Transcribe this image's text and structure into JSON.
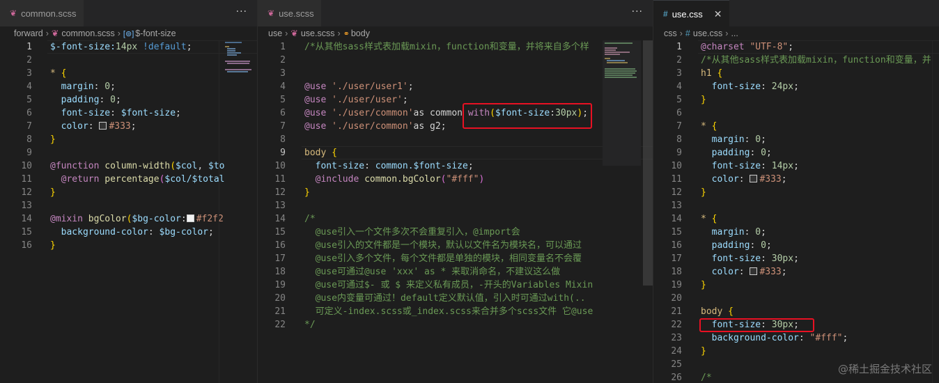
{
  "panes": [
    {
      "tab": {
        "label": "common.scss",
        "icon": "sass-icon"
      },
      "breadcrumb": [
        "forward",
        "common.scss",
        "$-font-size"
      ],
      "current_line": 1,
      "lines": [
        [
          [
            "$-font-size:",
            "var"
          ],
          [
            "14px",
            "num"
          ],
          [
            " !default",
            "kw"
          ],
          [
            ";",
            "p"
          ]
        ],
        [],
        [
          [
            "* ",
            "sel"
          ],
          [
            "{",
            "br1"
          ]
        ],
        [
          [
            "  margin",
            "prop"
          ],
          [
            ": ",
            "p"
          ],
          [
            "0",
            "num"
          ],
          [
            ";",
            "p"
          ]
        ],
        [
          [
            "  padding",
            "prop"
          ],
          [
            ": ",
            "p"
          ],
          [
            "0",
            "num"
          ],
          [
            ";",
            "p"
          ]
        ],
        [
          [
            "  font-size",
            "prop"
          ],
          [
            ": ",
            "p"
          ],
          [
            "$font-size",
            "var"
          ],
          [
            ";",
            "p"
          ]
        ],
        [
          [
            "  color",
            "prop"
          ],
          [
            ": ",
            "p"
          ],
          [
            "#333",
            "str",
            "#333333"
          ],
          [
            ";",
            "p"
          ]
        ],
        [
          [
            "}",
            "br1"
          ]
        ],
        [],
        [
          [
            "@function ",
            "at"
          ],
          [
            "column-width",
            "fn"
          ],
          [
            "(",
            "br1"
          ],
          [
            "$col",
            "var"
          ],
          [
            ", ",
            "p"
          ],
          [
            "$to",
            "var"
          ]
        ],
        [
          [
            "  @return ",
            "at"
          ],
          [
            "percentage",
            "fn"
          ],
          [
            "(",
            "br2"
          ],
          [
            "$col/$total",
            "var"
          ]
        ],
        [
          [
            "}",
            "br1"
          ]
        ],
        [],
        [
          [
            "@mixin ",
            "at"
          ],
          [
            "bgColor",
            "fn"
          ],
          [
            "(",
            "br1"
          ],
          [
            "$bg-color",
            "var"
          ],
          [
            ":",
            "p"
          ],
          [
            "#f2f2",
            "str",
            "#f2f2f2"
          ]
        ],
        [
          [
            "  background-color",
            "prop"
          ],
          [
            ": ",
            "p"
          ],
          [
            "$bg-color",
            "var"
          ],
          [
            ";",
            "p"
          ]
        ],
        [
          [
            "}",
            "br1"
          ]
        ]
      ]
    },
    {
      "tab": {
        "label": "use.scss",
        "icon": "sass-icon"
      },
      "breadcrumb": [
        "use",
        "use.scss",
        "body"
      ],
      "current_line": 9,
      "lines": [
        [
          [
            "/*从其他sass样式表加载mixin，function和变量，并将来自多个样",
            "com"
          ]
        ],
        [],
        [],
        [
          [
            "@use ",
            "at"
          ],
          [
            "'./user/user1'",
            "str"
          ],
          [
            ";",
            "p"
          ]
        ],
        [
          [
            "@use ",
            "at"
          ],
          [
            "'./user/user'",
            "str"
          ],
          [
            ";",
            "p"
          ]
        ],
        [
          [
            "@use ",
            "at"
          ],
          [
            "'./user/common'",
            "str"
          ],
          [
            "as common ",
            "p"
          ],
          [
            "with",
            "at"
          ],
          [
            "(",
            "br1"
          ],
          [
            "$font-size",
            "var"
          ],
          [
            ":",
            "p"
          ],
          [
            "30px",
            "num"
          ],
          [
            ")",
            "br1"
          ],
          [
            ";",
            "p"
          ]
        ],
        [
          [
            "@use ",
            "at"
          ],
          [
            "'./user/common'",
            "str"
          ],
          [
            "as g2",
            "p"
          ],
          [
            ";",
            "p"
          ]
        ],
        [],
        [
          [
            "body ",
            "tag"
          ],
          [
            "{",
            "br1"
          ]
        ],
        [
          [
            "  font-size",
            "prop"
          ],
          [
            ": ",
            "p"
          ],
          [
            "common.$font-size",
            "var"
          ],
          [
            ";",
            "p"
          ]
        ],
        [
          [
            "  @include ",
            "at"
          ],
          [
            "common.bgColor",
            "fn"
          ],
          [
            "(",
            "br2"
          ],
          [
            "\"#fff\"",
            "str"
          ],
          [
            ")",
            "br2"
          ]
        ],
        [
          [
            "}",
            "br1"
          ]
        ],
        [],
        [
          [
            "/*",
            "com"
          ]
        ],
        [
          [
            "  @use引入一个文件多次不会重复引入，@import会",
            "com"
          ]
        ],
        [
          [
            "  @use引入的文件都是一个模块，默认以文件名为模块名，可以通过",
            "com"
          ]
        ],
        [
          [
            "  @use引入多个文件，每个文件都是单独的模块，相同变量名不会覆",
            "com"
          ]
        ],
        [
          [
            "  @use可通过@use 'xxx' as * 来取消命名，不建议这么做",
            "com"
          ]
        ],
        [
          [
            "  @use可通过$- 或 $ 来定义私有成员，-开头的Variables Mixin",
            "com"
          ]
        ],
        [
          [
            "  @use内变量可通过！default定义默认值，引入时可通过with(..",
            "com"
          ]
        ],
        [
          [
            "  可定义-index.scss或_index.scss来合并多个scss文件 它@use",
            "com"
          ]
        ],
        [
          [
            "*/",
            "com"
          ]
        ]
      ]
    },
    {
      "tab": {
        "label": "use.css",
        "icon": "css-hash-icon"
      },
      "breadcrumb": [
        "css",
        "use.css",
        "..."
      ],
      "current_line": 1,
      "lines": [
        [
          [
            "@charset ",
            "at"
          ],
          [
            "\"UTF-8\"",
            "str"
          ],
          [
            ";",
            "p"
          ]
        ],
        [
          [
            "/*从其他sass样式表加载mixin，function和变量，并",
            "com"
          ]
        ],
        [
          [
            "h1 ",
            "tag"
          ],
          [
            "{",
            "br1"
          ]
        ],
        [
          [
            "  font-size",
            "prop"
          ],
          [
            ": ",
            "p"
          ],
          [
            "24px",
            "num"
          ],
          [
            ";",
            "p"
          ]
        ],
        [
          [
            "}",
            "br1"
          ]
        ],
        [],
        [
          [
            "* ",
            "sel"
          ],
          [
            "{",
            "br1"
          ]
        ],
        [
          [
            "  margin",
            "prop"
          ],
          [
            ": ",
            "p"
          ],
          [
            "0",
            "num"
          ],
          [
            ";",
            "p"
          ]
        ],
        [
          [
            "  padding",
            "prop"
          ],
          [
            ": ",
            "p"
          ],
          [
            "0",
            "num"
          ],
          [
            ";",
            "p"
          ]
        ],
        [
          [
            "  font-size",
            "prop"
          ],
          [
            ": ",
            "p"
          ],
          [
            "14px",
            "num"
          ],
          [
            ";",
            "p"
          ]
        ],
        [
          [
            "  color",
            "prop"
          ],
          [
            ": ",
            "p"
          ],
          [
            "#333",
            "str",
            "#333333"
          ],
          [
            ";",
            "p"
          ]
        ],
        [
          [
            "}",
            "br1"
          ]
        ],
        [],
        [
          [
            "* ",
            "sel"
          ],
          [
            "{",
            "br1"
          ]
        ],
        [
          [
            "  margin",
            "prop"
          ],
          [
            ": ",
            "p"
          ],
          [
            "0",
            "num"
          ],
          [
            ";",
            "p"
          ]
        ],
        [
          [
            "  padding",
            "prop"
          ],
          [
            ": ",
            "p"
          ],
          [
            "0",
            "num"
          ],
          [
            ";",
            "p"
          ]
        ],
        [
          [
            "  font-size",
            "prop"
          ],
          [
            ": ",
            "p"
          ],
          [
            "30px",
            "num"
          ],
          [
            ";",
            "p"
          ]
        ],
        [
          [
            "  color",
            "prop"
          ],
          [
            ": ",
            "p"
          ],
          [
            "#333",
            "str",
            "#333333"
          ],
          [
            ";",
            "p"
          ]
        ],
        [
          [
            "}",
            "br1"
          ]
        ],
        [],
        [
          [
            "body ",
            "tag"
          ],
          [
            "{",
            "br1"
          ]
        ],
        [
          [
            "  font-size",
            "prop"
          ],
          [
            ": ",
            "p"
          ],
          [
            "30px",
            "num"
          ],
          [
            ";",
            "p"
          ]
        ],
        [
          [
            "  background-color",
            "prop"
          ],
          [
            ": ",
            "p"
          ],
          [
            "\"#fff\"",
            "str"
          ],
          [
            ";",
            "p"
          ]
        ],
        [
          [
            "}",
            "br1"
          ]
        ],
        [],
        [
          [
            "/*",
            "com"
          ]
        ]
      ]
    }
  ],
  "more_actions_label": "···",
  "close_label": "✕",
  "watermark": "@稀土掘金技术社区",
  "colors": {
    "highlight_box": "#e81123",
    "editor_bg": "#1e1e1e",
    "tabbar_bg": "#252526",
    "sass_icon": "#cd6799",
    "css_icon": "#519aba"
  }
}
